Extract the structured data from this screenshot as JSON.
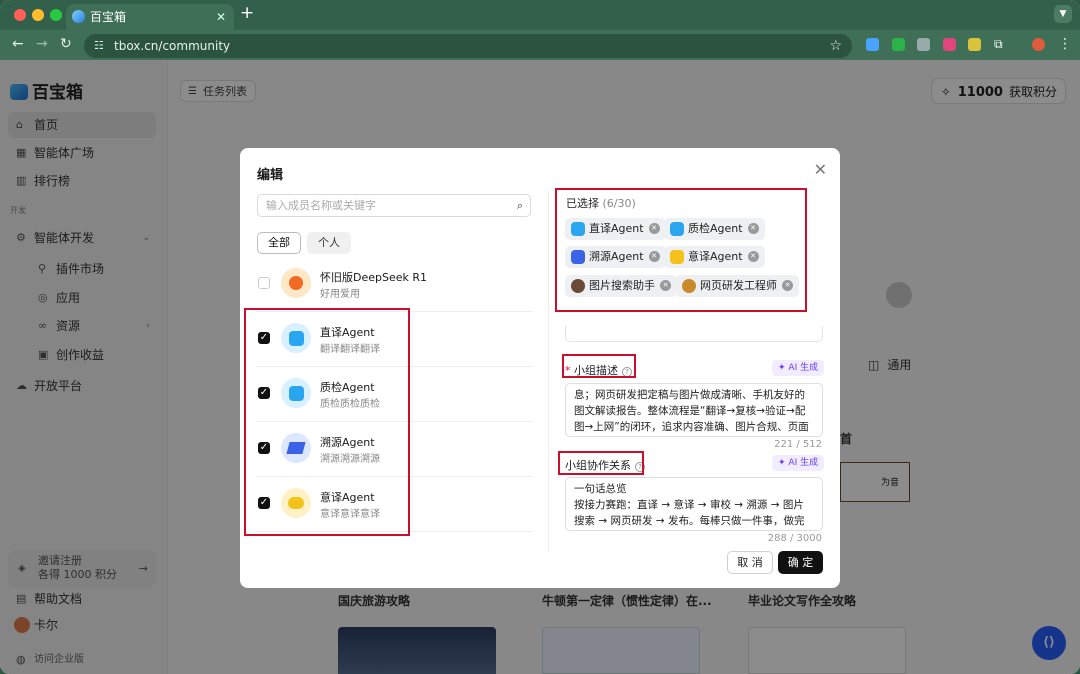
{
  "browser": {
    "tab_title": "百宝箱",
    "url": "tbox.cn/community"
  },
  "sidebar": {
    "logo": "百宝箱",
    "items": [
      {
        "label": "首页",
        "icon": "home-icon"
      },
      {
        "label": "智能体广场",
        "icon": "grid-icon"
      },
      {
        "label": "排行榜",
        "icon": "chart-icon"
      }
    ],
    "section_label": "开发",
    "dev_items": [
      {
        "label": "智能体开发",
        "icon": "gear-icon"
      },
      {
        "label": "插件市场",
        "icon": "plug-icon"
      },
      {
        "label": "应用",
        "icon": "app-icon"
      },
      {
        "label": "资源",
        "icon": "link-icon"
      },
      {
        "label": "创作收益",
        "icon": "coin-icon"
      },
      {
        "label": "开放平台",
        "icon": "cloud-icon"
      }
    ],
    "invite_line1": "邀请注册",
    "invite_line2": "各得 1000 积分",
    "help": "帮助文档",
    "user": "卡尔",
    "enterprise": "访问企业版"
  },
  "main": {
    "task_list": "任务列表",
    "points_value": "11000",
    "points_label": "获取积分",
    "general": "通用",
    "card_titles": [
      "国庆旅游攻略",
      "牛顿第一定律（惯性定律）在...",
      "毕业论文写作全攻略"
    ],
    "bg_fragment": "首",
    "bg_card_text": "为音"
  },
  "modal": {
    "title": "编辑",
    "search_placeholder": "输入成员名称或关键字",
    "filter_all": "全部",
    "filter_personal": "个人",
    "agents": [
      {
        "name": "怀旧版DeepSeek R1",
        "desc": "好用爱用",
        "checked": false
      },
      {
        "name": "直译Agent",
        "desc": "翻译翻译翻译",
        "checked": true
      },
      {
        "name": "质检Agent",
        "desc": "质检质检质检",
        "checked": true
      },
      {
        "name": "溯源Agent",
        "desc": "溯源溯源溯源",
        "checked": true
      },
      {
        "name": "意译Agent",
        "desc": "意译意译意译",
        "checked": true
      }
    ],
    "selected_label": "已选择",
    "selected_count": "(6/30)",
    "selected_chips": [
      "直译Agent",
      "质检Agent",
      "溯源Agent",
      "意译Agent",
      "图片搜索助手",
      "网页研发工程师"
    ],
    "group_desc_label": "小组描述",
    "ai_generate": "AI 生成",
    "group_desc_text": "息；网页研发把定稿与图片做成清晰、手机友好的图文解读报告。整体流程是“翻译→复核→验证→配图→上网”的闭环，追求内容准确、图片合规、页面好读。",
    "group_desc_count": "221 / 512",
    "collab_label": "小组协作关系",
    "collab_text_line1": "一句话总览",
    "collab_text_line2": "按接力赛跑：直译 → 意译 → 审校 → 溯源 → 图片搜索 → 网页研发 → 发布。每棒只做一件事，做完把“接力",
    "collab_count": "288 / 3000",
    "cancel": "取 消",
    "confirm": "确 定"
  }
}
